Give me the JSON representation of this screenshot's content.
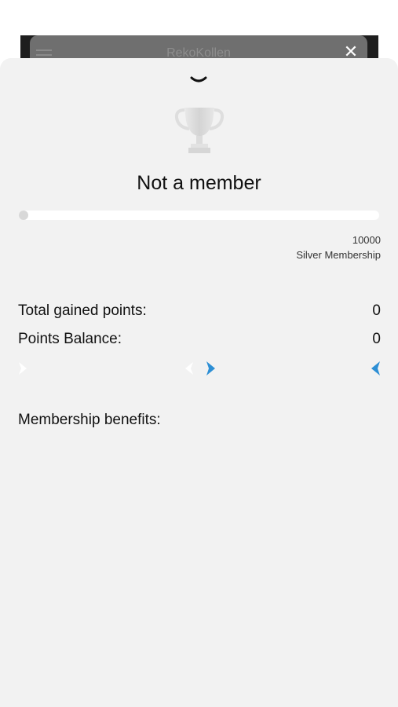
{
  "background_app": {
    "title": "RekoKollen",
    "close_glyph": "✕",
    "menu_icon": "menu-icon"
  },
  "sheet": {
    "collapse_icon": "chevron-down-icon",
    "trophy_icon": "trophy-icon",
    "status_title": "Not a member",
    "progress": {
      "current_points": 0,
      "target_points": 10000,
      "fraction": 0
    },
    "next_tier": {
      "points_label": "10000",
      "name": "Silver Membership"
    },
    "stats": {
      "total_gained_label": "Total gained points:",
      "total_gained_value": "0",
      "balance_label": "Points Balance:",
      "balance_value": "0"
    },
    "carousel": {
      "accent_color": "#2d8fd5",
      "faded_color": "#ffffff"
    },
    "benefits_title": "Membership benefits:"
  }
}
